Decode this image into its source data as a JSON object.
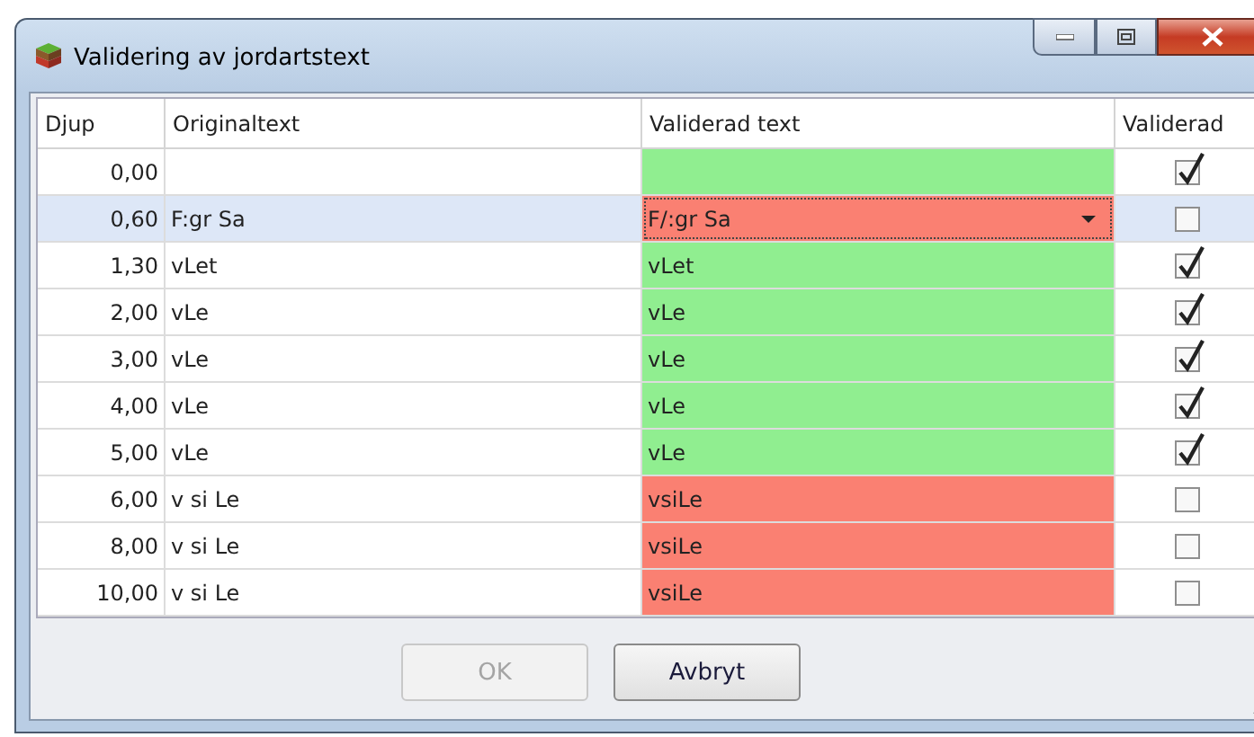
{
  "window": {
    "title": "Validering av jordartstext"
  },
  "table": {
    "columns": [
      "Djup",
      "Originaltext",
      "Validerad text",
      "Validerad"
    ],
    "rows": [
      {
        "depth": "0,00",
        "original": "",
        "validated": "",
        "color": "#90ee90",
        "checked": true,
        "selected": false,
        "editing": false
      },
      {
        "depth": "0,60",
        "original": "F:gr Sa",
        "validated": "F/:gr Sa",
        "color": "#fa8072",
        "checked": false,
        "selected": true,
        "editing": true
      },
      {
        "depth": "1,30",
        "original": "vLet",
        "validated": "vLet",
        "color": "#90ee90",
        "checked": true,
        "selected": false,
        "editing": false
      },
      {
        "depth": "2,00",
        "original": "vLe",
        "validated": "vLe",
        "color": "#90ee90",
        "checked": true,
        "selected": false,
        "editing": false
      },
      {
        "depth": "3,00",
        "original": "vLe",
        "validated": "vLe",
        "color": "#90ee90",
        "checked": true,
        "selected": false,
        "editing": false
      },
      {
        "depth": "4,00",
        "original": "vLe",
        "validated": "vLe",
        "color": "#90ee90",
        "checked": true,
        "selected": false,
        "editing": false
      },
      {
        "depth": "5,00",
        "original": "vLe",
        "validated": "vLe",
        "color": "#90ee90",
        "checked": true,
        "selected": false,
        "editing": false
      },
      {
        "depth": "6,00",
        "original": "v si Le",
        "validated": "vsiLe",
        "color": "#fa8072",
        "checked": false,
        "selected": false,
        "editing": false
      },
      {
        "depth": "8,00",
        "original": "v si Le",
        "validated": "vsiLe",
        "color": "#fa8072",
        "checked": false,
        "selected": false,
        "editing": false
      },
      {
        "depth": "10,00",
        "original": "v si Le",
        "validated": "vsiLe",
        "color": "#fa8072",
        "checked": false,
        "selected": false,
        "editing": false
      }
    ]
  },
  "buttons": [
    {
      "label": "OK",
      "disabled": true
    },
    {
      "label": "Avbryt",
      "disabled": false
    }
  ]
}
